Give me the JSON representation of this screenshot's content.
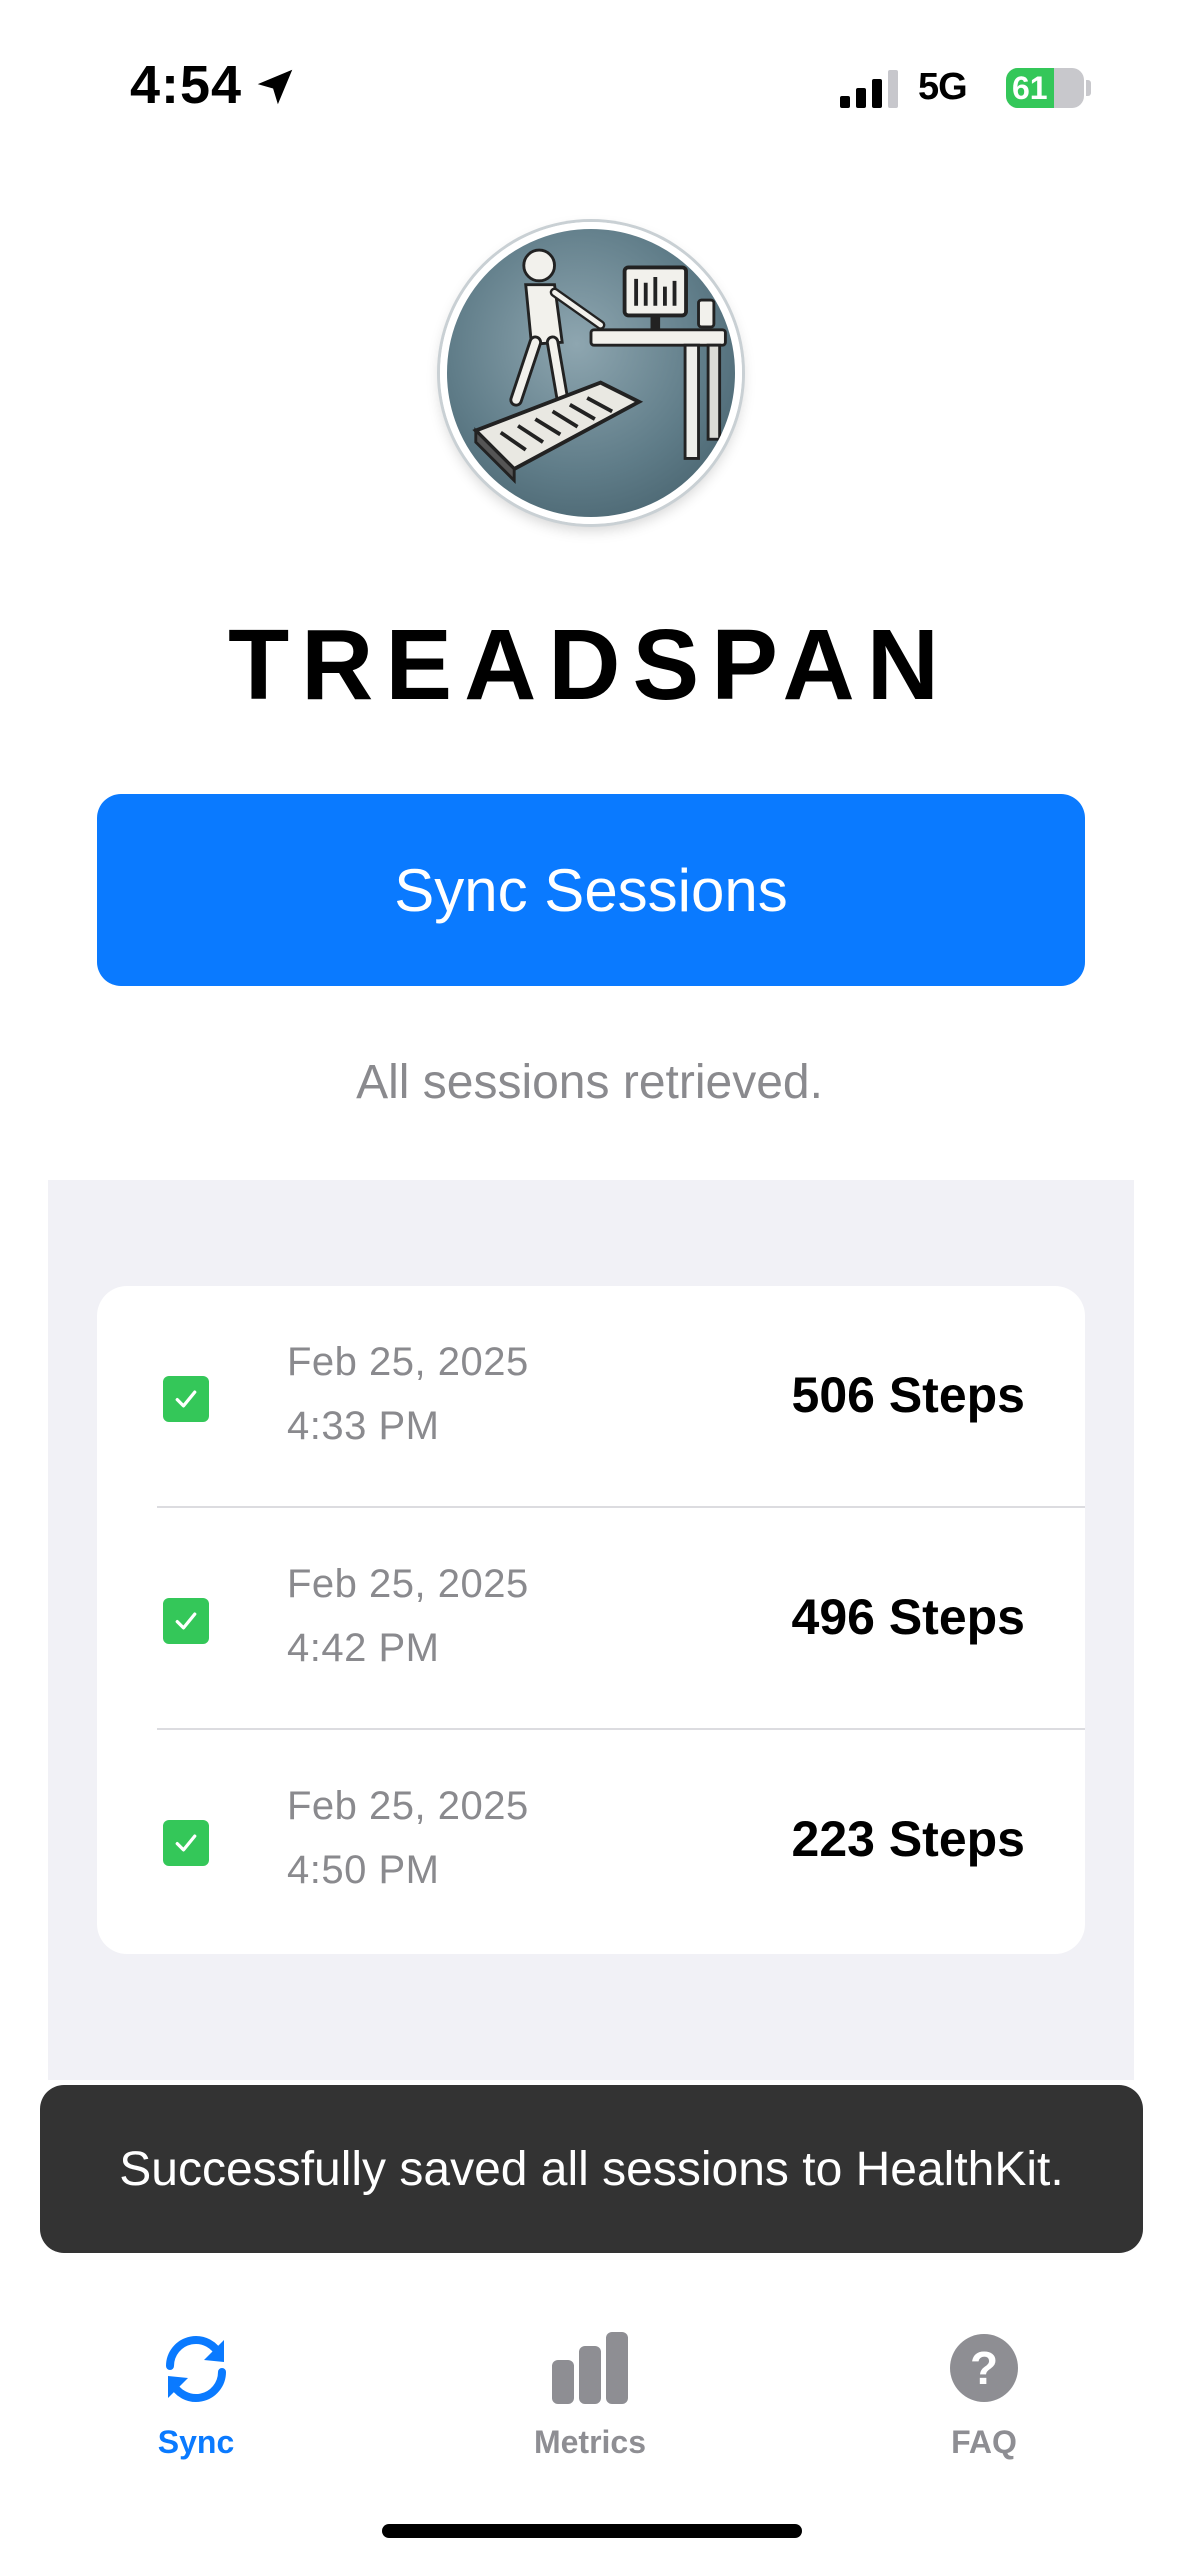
{
  "status_bar": {
    "time": "4:54",
    "network": "5G",
    "battery_level": "61",
    "battery_fraction": 0.61,
    "icons": [
      "location-arrow-icon",
      "cellular-signal-icon",
      "battery-charging-icon"
    ]
  },
  "app": {
    "title": "TREADSPAN",
    "logo_icon": "treadmill-desk-logo"
  },
  "sync": {
    "button_label": "Sync Sessions",
    "status": "All sessions retrieved."
  },
  "sessions": [
    {
      "date": "Feb 25, 2025",
      "time": "4:33 PM",
      "steps": "506 Steps",
      "checked": true
    },
    {
      "date": "Feb 25, 2025",
      "time": "4:42 PM",
      "steps": "496 Steps",
      "checked": true
    },
    {
      "date": "Feb 25, 2025",
      "time": "4:50 PM",
      "steps": "223 Steps",
      "checked": true
    }
  ],
  "toast": {
    "message": "Successfully saved all sessions to HealthKit."
  },
  "tabs": [
    {
      "label": "Sync",
      "icon": "sync-arrows-icon",
      "active": true
    },
    {
      "label": "Metrics",
      "icon": "bar-chart-icon",
      "active": false
    },
    {
      "label": "FAQ",
      "icon": "question-circle-icon",
      "active": false
    }
  ],
  "colors": {
    "accent": "#0a7aff",
    "check": "#34c759",
    "secondary_text": "#8a8a8e",
    "panel_bg": "#f1f1f6",
    "toast_bg": "#333333",
    "inactive_tab": "#8e8e93"
  }
}
